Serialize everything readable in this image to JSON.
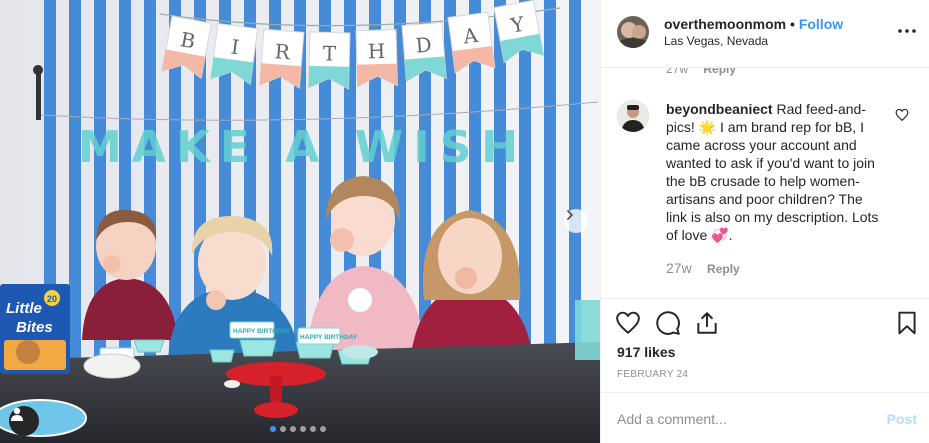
{
  "photo": {
    "banner_top": [
      "B",
      "I",
      "R",
      "T",
      "H",
      "D",
      "A",
      "Y"
    ],
    "banner_bottom": "MAKE A WISH",
    "product_box": [
      "Little",
      "Bites",
      "20"
    ],
    "cupcake_text": "HAPPY BIRTHDAY",
    "carousel": {
      "count": 6,
      "active": 0
    },
    "colors": {
      "stripe_blue": "#3d86d6",
      "wall": "#eef0f4",
      "table": "#3b3d44",
      "stand_red": "#d6202a",
      "teal": "#7fd8d6",
      "pink": "#f4b8a6"
    }
  },
  "post": {
    "username": "overthemoonmom",
    "separator": "•",
    "follow_label": "Follow",
    "location": "Las Vegas, Nevada",
    "more_icon": "more-horizontal-icon"
  },
  "comments": {
    "previous_time": "27w",
    "previous_reply": "Reply",
    "items": [
      {
        "username": "beyondbeaniect",
        "text_before": "Rad feed-and-pics! ",
        "emoji1": "🌟",
        "text_middle": " I am brand rep for bB, I came across your account and wanted to ask if you'd want to join the bB crusade to help women-artisans and poor children? The link is also on my description. Lots of love ",
        "emoji2": "💞",
        "text_after": ".",
        "time": "27w",
        "reply_label": "Reply"
      }
    ]
  },
  "actions": {
    "like_icon": "heart-icon",
    "comment_icon": "comment-icon",
    "share_icon": "share-icon",
    "save_icon": "bookmark-icon"
  },
  "likes_text": "917 likes",
  "date_text": "FEBRUARY 24",
  "add_comment": {
    "placeholder": "Add a comment...",
    "post_label": "Post"
  }
}
